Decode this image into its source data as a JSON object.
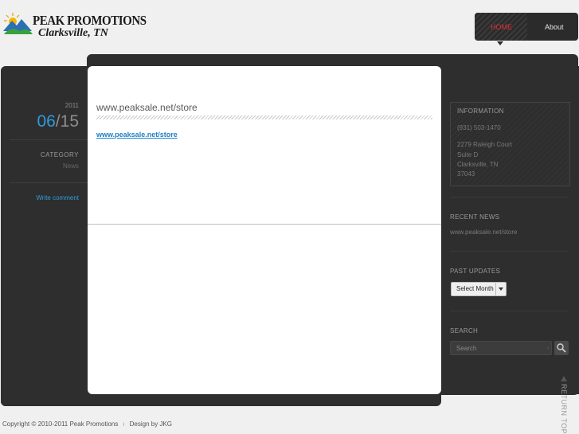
{
  "header": {
    "logo_line1": "PEAK PROMOTIONS",
    "logo_line2": "Clarksville, TN"
  },
  "nav": [
    {
      "label": "HOME",
      "active": true
    },
    {
      "label": "About",
      "active": false
    }
  ],
  "post": {
    "year": "2011",
    "month": "06",
    "slash": "/",
    "day": "15",
    "category_heading": "CATEGORY",
    "category": "News",
    "write_comment": "Write comment",
    "title": "www.peaksale.net/store",
    "link": "www.peaksale.net/store"
  },
  "sidebar": {
    "info_heading": "INFORMATION",
    "phone": "(931) 503-1470",
    "address": [
      "2279 Raleigh Court",
      "Suite D",
      "Clarksville, TN",
      "37043"
    ],
    "recent_heading": "RECENT NEWS",
    "recent_item": "www.peaksale.net/store",
    "past_heading": "PAST UPDATES",
    "select_value": "Select Month",
    "search_heading": "SEARCH",
    "search_value": "Search"
  },
  "return_top": "RETURN TOP",
  "footer": {
    "copyright": "Copyright © 2010-2011 Peak Promotions",
    "separator": "ı",
    "design": "Design by JKG"
  },
  "colors": {
    "accent_blue": "#2e9be0",
    "nav_active": "#e0303a",
    "dark_panel": "#2e2e2e"
  }
}
